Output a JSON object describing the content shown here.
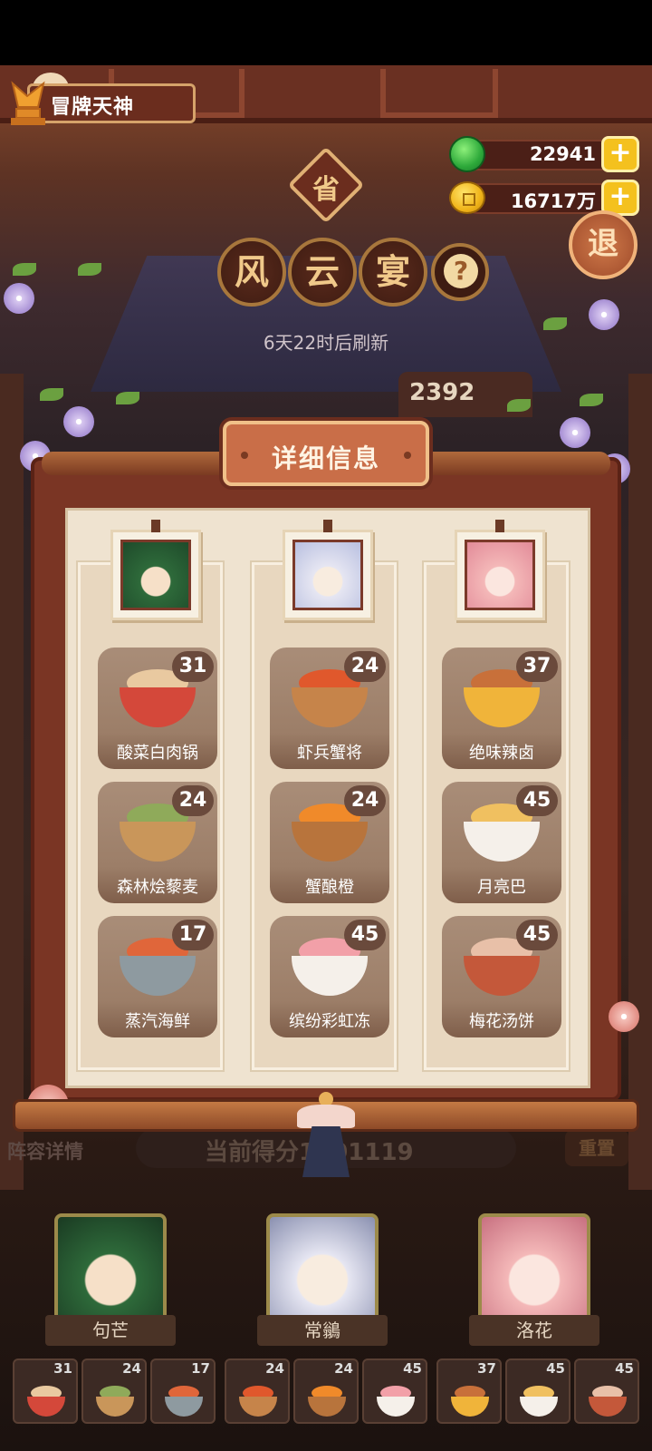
{
  "player": {
    "title": "冒牌天神"
  },
  "currency": {
    "gems": {
      "value": "22941",
      "icon": "jade-gem-icon"
    },
    "coins": {
      "value": "16717万",
      "icon": "copper-coin-icon"
    },
    "plus_label": "+"
  },
  "province_badge": "省",
  "exit_label": "退",
  "event": {
    "chars": [
      "风",
      "云",
      "宴"
    ],
    "help": "?",
    "refresh": "6天22时后刷新",
    "partial_score": "2392"
  },
  "panel": {
    "title": "详细信息",
    "heroes": [
      {
        "portrait": "green-hair-hero-portrait",
        "dishes": [
          {
            "name": "酸菜白肉锅",
            "count": "31",
            "color": "#d4483a",
            "top": "#e9c9a0"
          },
          {
            "name": "森林烩藜麦",
            "count": "24",
            "color": "#c9965a",
            "top": "#8faa5a"
          },
          {
            "name": "蒸汽海鲜",
            "count": "17",
            "color": "#8e9aa0",
            "top": "#e0663a"
          }
        ]
      },
      {
        "portrait": "white-hair-hero-portrait",
        "dishes": [
          {
            "name": "虾兵蟹将",
            "count": "24",
            "color": "#c6844a",
            "top": "#e0582c"
          },
          {
            "name": "蟹酿橙",
            "count": "24",
            "color": "#b8743c",
            "top": "#f08a2a"
          },
          {
            "name": "缤纷彩虹冻",
            "count": "45",
            "color": "#f5f0ea",
            "top": "#f2a0a8"
          }
        ]
      },
      {
        "portrait": "pink-hair-hero-portrait",
        "dishes": [
          {
            "name": "绝味辣卤",
            "count": "37",
            "color": "#f0b43a",
            "top": "#c8703a"
          },
          {
            "name": "月亮巴",
            "count": "45",
            "color": "#f5f0ea",
            "top": "#f0c060"
          },
          {
            "name": "梅花汤饼",
            "count": "45",
            "color": "#c4583a",
            "top": "#e8c0a8"
          }
        ]
      }
    ]
  },
  "lineup": {
    "label": "阵容详情",
    "score": "当前得分1101119",
    "reset_label": "重置",
    "heroes": [
      {
        "name": "句芒"
      },
      {
        "name": "常鶲"
      },
      {
        "name": "洛花"
      }
    ],
    "slots": [
      {
        "count": "31",
        "color": "#d4483a",
        "top": "#e9c9a0"
      },
      {
        "count": "24",
        "color": "#c9965a",
        "top": "#8faa5a"
      },
      {
        "count": "17",
        "color": "#8e9aa0",
        "top": "#e0663a"
      },
      {
        "count": "24",
        "color": "#c6844a",
        "top": "#e0582c"
      },
      {
        "count": "24",
        "color": "#b8743c",
        "top": "#f08a2a"
      },
      {
        "count": "45",
        "color": "#f5f0ea",
        "top": "#f2a0a8"
      },
      {
        "count": "37",
        "color": "#f0b43a",
        "top": "#c8703a"
      },
      {
        "count": "45",
        "color": "#f5f0ea",
        "top": "#f0c060"
      },
      {
        "count": "45",
        "color": "#c4583a",
        "top": "#e8c0a8"
      }
    ]
  }
}
